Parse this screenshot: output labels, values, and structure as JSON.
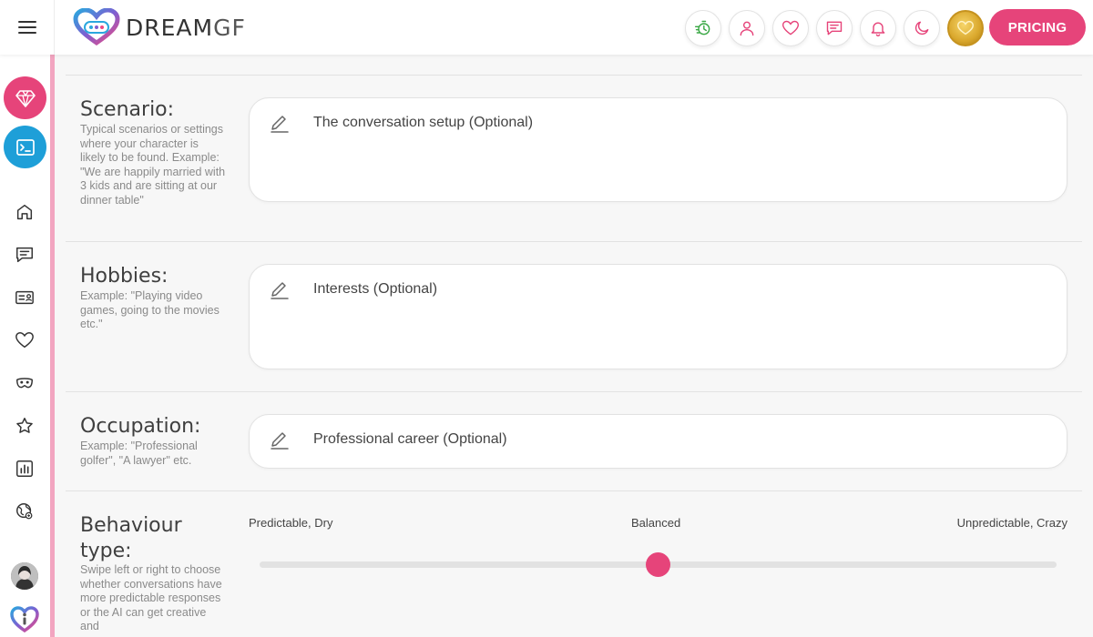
{
  "header": {
    "logo_main": "DREAM",
    "logo_accent": "GF",
    "pricing_label": "PRICING",
    "icons": [
      "timer-icon",
      "user-icon",
      "heart-icon",
      "chat-icon",
      "bell-icon",
      "moon-icon",
      "coin-icon"
    ]
  },
  "sidebar": {
    "items": [
      "diamond-icon",
      "terminal-icon",
      "home-icon",
      "chat-icon",
      "id-card-icon",
      "heart-icon",
      "mask-icon",
      "star-icon",
      "chart-icon",
      "globe-icon",
      "avatar",
      "logo-icon"
    ]
  },
  "sections": {
    "scenario": {
      "title": "Scenario:",
      "description": "Typical scenarios or settings where your character is likely to be found. Example: \"We are happily married with 3 kids and are sitting at our dinner table\"",
      "placeholder": "The conversation setup (Optional)"
    },
    "hobbies": {
      "title": "Hobbies:",
      "description": "Example: \"Playing video games, going to the movies etc.\"",
      "placeholder": "Interests (Optional)"
    },
    "occupation": {
      "title": "Occupation:",
      "description": "Example: \"Professional golfer\", \"A lawyer\" etc.",
      "placeholder": "Professional career (Optional)"
    },
    "behaviour": {
      "title_line1": "Behaviour",
      "title_line2": "type:",
      "description": "Swipe left or right to choose whether conversations have more predictable responses or the AI can get creative and",
      "label_left": "Predictable, Dry",
      "label_center": "Balanced",
      "label_right": "Unpredictable, Crazy",
      "slider_value": 0.5
    }
  },
  "colors": {
    "accent": "#e6447a",
    "terminal": "#1e9fd8",
    "stripe": "#f2a5c0"
  }
}
